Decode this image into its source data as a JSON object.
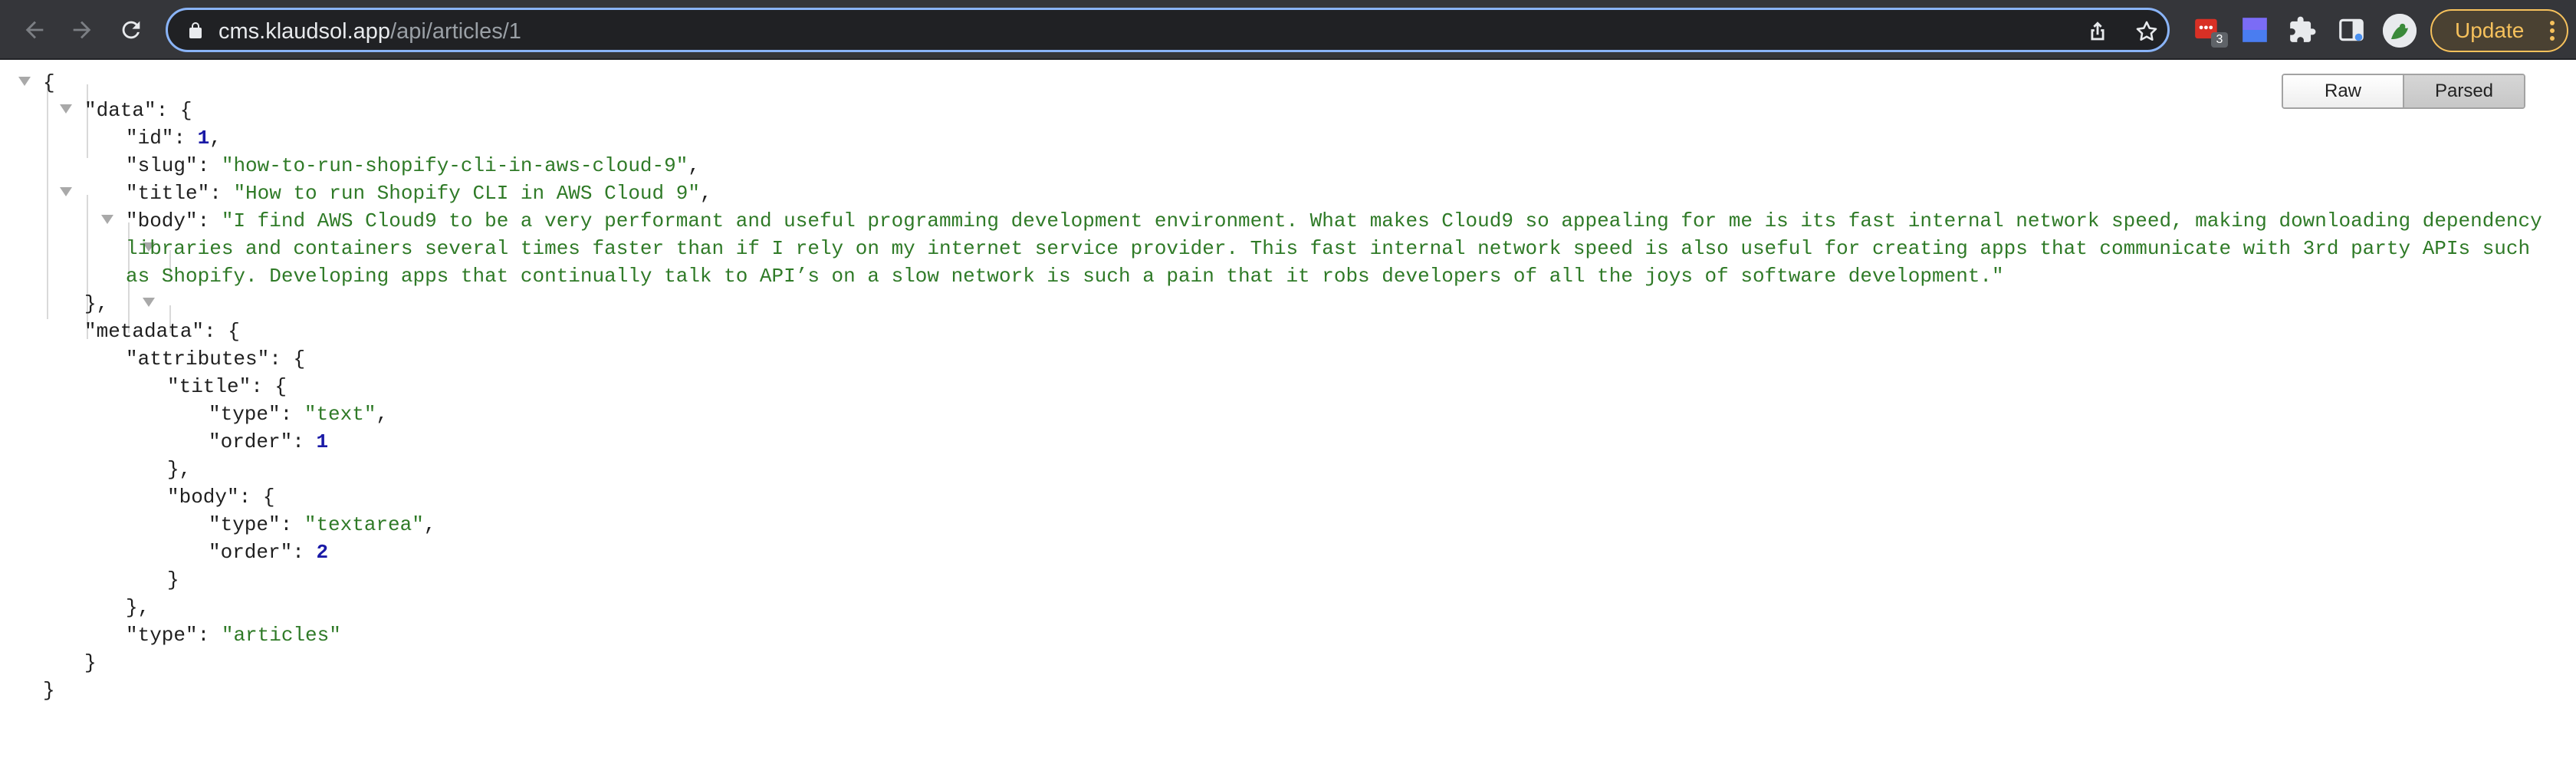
{
  "browser": {
    "url_host": "cms.klaudsol.app",
    "url_path": "/api/articles/1",
    "update_label": "Update",
    "extension_badge": "3",
    "icons": [
      "back-icon",
      "forward-icon",
      "reload-icon",
      "lock-icon",
      "share-icon",
      "bookmark-star-icon",
      "extension-icon",
      "extensions-puzzle-icon",
      "sidebar-icon",
      "profile-avatar",
      "menu-dots-icon"
    ]
  },
  "viewer": {
    "raw_label": "Raw",
    "parsed_label": "Parsed",
    "active_mode": "Parsed"
  },
  "json": {
    "data": {
      "id": "1",
      "slug": "\"how-to-run-shopify-cli-in-aws-cloud-9\"",
      "title": "\"How to run Shopify CLI in AWS Cloud 9\"",
      "body_line1": "\"I find AWS Cloud9 to be a very performant and useful programming development environment. What makes Cloud9 so appealing for me is its fast internal network speed, making downloading dependency",
      "body_line2": "libraries and containers several times faster than if I rely on my internet service provider. This fast internal network speed is also useful for creating apps that communicate with 3rd party APIs such",
      "body_line3": "as Shopify. Developing apps that continually talk to API’s on a slow network is such a pain that it robs developers of all the joys of software development.\""
    },
    "metadata": {
      "title_type": "\"text\"",
      "title_order": "1",
      "body_type": "\"textarea\"",
      "body_order": "2",
      "type": "\"articles\""
    },
    "keys": {
      "data": "\"data\"",
      "id": "\"id\"",
      "slug": "\"slug\"",
      "title": "\"title\"",
      "body": "\"body\"",
      "metadata": "\"metadata\"",
      "attributes": "\"attributes\"",
      "type": "\"type\"",
      "order": "\"order\""
    }
  },
  "colors": {
    "toolbar_bg": "#35363a",
    "omnibox_border": "#8ab4f8",
    "string_color": "#2f7a27",
    "number_color": "#1a1aa6",
    "update_accent": "#f6c15c"
  }
}
